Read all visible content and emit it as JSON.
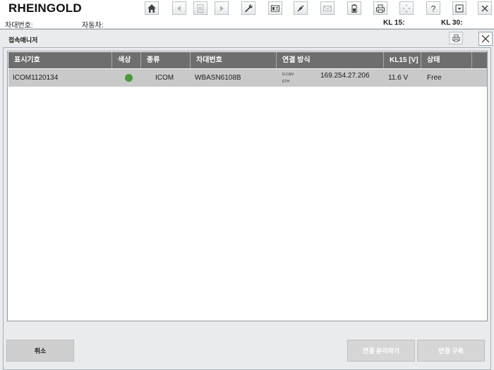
{
  "app": {
    "title": "RHEINGOLD"
  },
  "infobar": {
    "vin_label": "차대번호:",
    "car_label": "자동차:",
    "kl15_label": "KL 15:",
    "kl30_label": "KL 30:"
  },
  "toolbar": [
    {
      "icon": "home-icon",
      "enabled": true
    },
    {
      "icon": "back-icon",
      "enabled": false
    },
    {
      "icon": "document-icon",
      "enabled": false
    },
    {
      "icon": "forward-icon",
      "enabled": false
    },
    {
      "icon": "wrench-icon",
      "enabled": true
    },
    {
      "icon": "data-icon",
      "enabled": true
    },
    {
      "icon": "connection-icon",
      "enabled": true
    },
    {
      "icon": "mail-icon",
      "enabled": false
    },
    {
      "icon": "battery-icon",
      "enabled": true
    },
    {
      "icon": "printer-icon",
      "enabled": true
    },
    {
      "icon": "loading-icon",
      "enabled": false
    },
    {
      "icon": "help-icon",
      "enabled": true
    },
    {
      "icon": "minimize-icon",
      "enabled": true
    },
    {
      "icon": "close-icon",
      "enabled": true
    }
  ],
  "dialog": {
    "title": "접속매니저",
    "columns": [
      "표시기호",
      "색상",
      "종류",
      "차대번호",
      "연결 방식",
      "KL15 [V]",
      "상태"
    ],
    "rows": [
      {
        "designation": "ICOM1120134",
        "color": "#4a9a3a",
        "type": "ICOM",
        "vin": "WBASN6108B",
        "conn_top": "D-CAN",
        "conn_bottom": "ETH",
        "ip": "169.254.27.206",
        "kl15": "11.6 V",
        "status": "Free"
      }
    ],
    "buttons": {
      "cancel": "취소",
      "disconnect": "연결 분리하기",
      "connect": "연결 구축"
    }
  }
}
